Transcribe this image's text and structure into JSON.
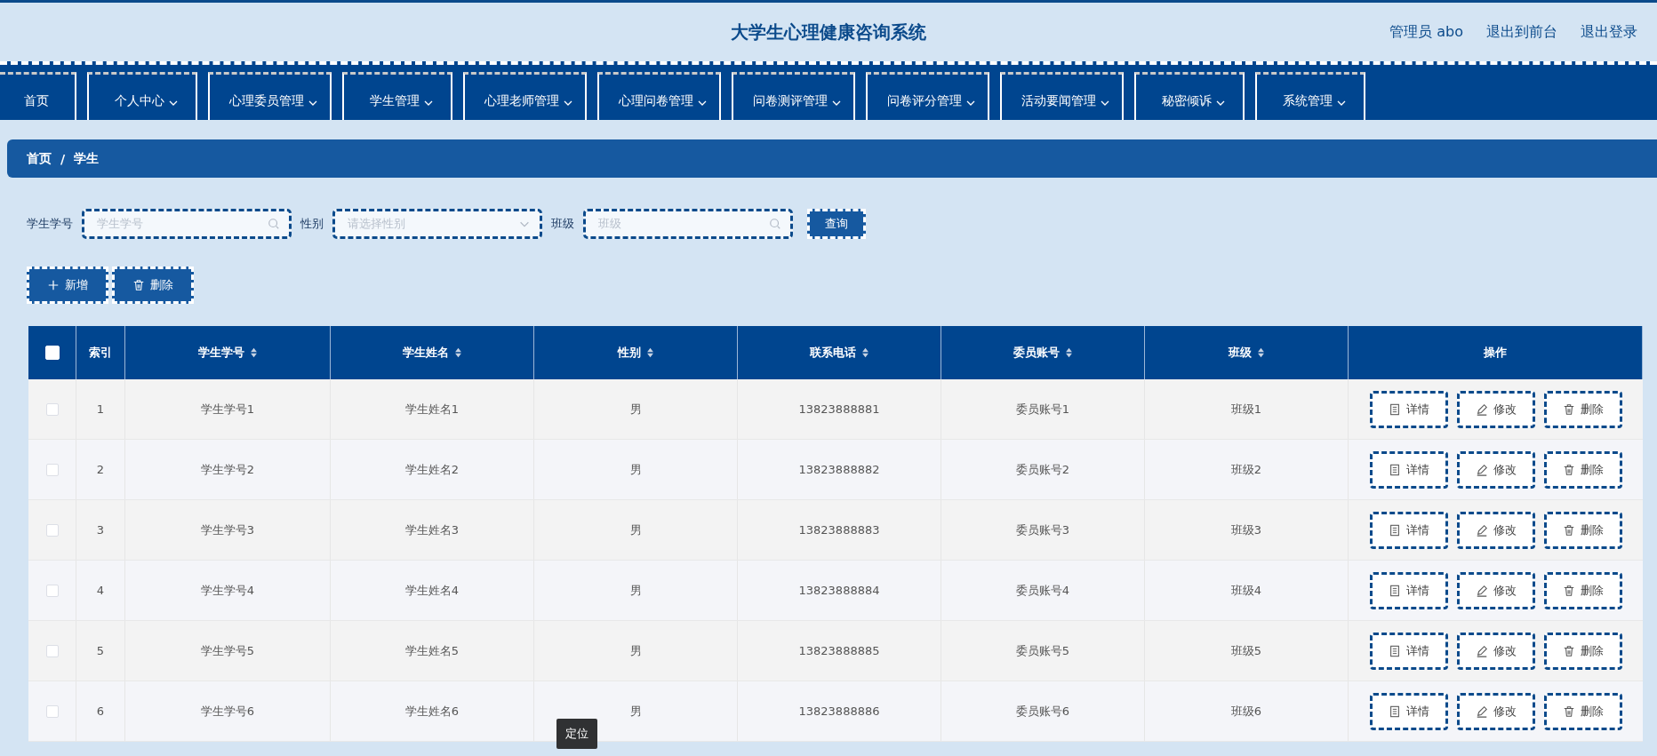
{
  "header": {
    "title": "大学生心理健康咨询系统",
    "user": "管理员 abo",
    "links": [
      "退出到前台",
      "退出登录"
    ]
  },
  "nav": [
    {
      "label": "首页",
      "dropdown": false
    },
    {
      "label": "个人中心",
      "dropdown": true
    },
    {
      "label": "心理委员管理",
      "dropdown": true
    },
    {
      "label": "学生管理",
      "dropdown": true
    },
    {
      "label": "心理老师管理",
      "dropdown": true
    },
    {
      "label": "心理问卷管理",
      "dropdown": true
    },
    {
      "label": "问卷测评管理",
      "dropdown": true
    },
    {
      "label": "问卷评分管理",
      "dropdown": true
    },
    {
      "label": "活动要闻管理",
      "dropdown": true
    },
    {
      "label": "秘密倾诉",
      "dropdown": true
    },
    {
      "label": "系统管理",
      "dropdown": true
    }
  ],
  "breadcrumb": {
    "items": [
      "首页",
      "学生"
    ],
    "separator": "/"
  },
  "filters": [
    {
      "label": "学生学号",
      "kind": "search",
      "placeholder": "学生学号"
    },
    {
      "label": "性别",
      "kind": "select",
      "placeholder": "请选择性别"
    },
    {
      "label": "班级",
      "kind": "search",
      "placeholder": "班级"
    }
  ],
  "query_button": "查询",
  "actions": [
    {
      "label": "新增",
      "kind": "add"
    },
    {
      "label": "删除",
      "kind": "delete"
    }
  ],
  "table": {
    "select_all": {
      "checked": false
    },
    "columns": [
      {
        "label": "索引",
        "sortable": false
      },
      {
        "label": "学生学号",
        "sortable": true
      },
      {
        "label": "学生姓名",
        "sortable": true
      },
      {
        "label": "性别",
        "sortable": true
      },
      {
        "label": "联系电话",
        "sortable": true
      },
      {
        "label": "委员账号",
        "sortable": true
      },
      {
        "label": "班级",
        "sortable": true
      },
      {
        "label": "操作",
        "sortable": false
      }
    ],
    "rows": [
      {
        "selected": false,
        "cells": [
          "1",
          "学生学号1",
          "学生姓名1",
          "男",
          "13823888881",
          "委员账号1",
          "班级1"
        ],
        "actions": [
          {
            "label": "详情",
            "kind": "detail"
          },
          {
            "label": "修改",
            "kind": "edit"
          },
          {
            "label": "删除",
            "kind": "delete"
          }
        ]
      },
      {
        "selected": false,
        "cells": [
          "2",
          "学生学号2",
          "学生姓名2",
          "男",
          "13823888882",
          "委员账号2",
          "班级2"
        ],
        "actions": [
          {
            "label": "详情",
            "kind": "detail"
          },
          {
            "label": "修改",
            "kind": "edit"
          },
          {
            "label": "删除",
            "kind": "delete"
          }
        ]
      },
      {
        "selected": false,
        "cells": [
          "3",
          "学生学号3",
          "学生姓名3",
          "男",
          "13823888883",
          "委员账号3",
          "班级3"
        ],
        "actions": [
          {
            "label": "详情",
            "kind": "detail"
          },
          {
            "label": "修改",
            "kind": "edit"
          },
          {
            "label": "删除",
            "kind": "delete"
          }
        ]
      },
      {
        "selected": false,
        "cells": [
          "4",
          "学生学号4",
          "学生姓名4",
          "男",
          "13823888884",
          "委员账号4",
          "班级4"
        ],
        "actions": [
          {
            "label": "详情",
            "kind": "detail"
          },
          {
            "label": "修改",
            "kind": "edit"
          },
          {
            "label": "删除",
            "kind": "delete"
          }
        ]
      },
      {
        "selected": false,
        "cells": [
          "5",
          "学生学号5",
          "学生姓名5",
          "男",
          "13823888885",
          "委员账号5",
          "班级5"
        ],
        "actions": [
          {
            "label": "详情",
            "kind": "detail"
          },
          {
            "label": "修改",
            "kind": "edit"
          },
          {
            "label": "删除",
            "kind": "delete"
          }
        ]
      },
      {
        "selected": false,
        "cells": [
          "6",
          "学生学号6",
          "学生姓名6",
          "男",
          "13823888886",
          "委员账号6",
          "班级6"
        ],
        "actions": [
          {
            "label": "详情",
            "kind": "detail"
          },
          {
            "label": "修改",
            "kind": "edit"
          },
          {
            "label": "删除",
            "kind": "delete"
          }
        ]
      }
    ]
  },
  "tooltip": "定位"
}
